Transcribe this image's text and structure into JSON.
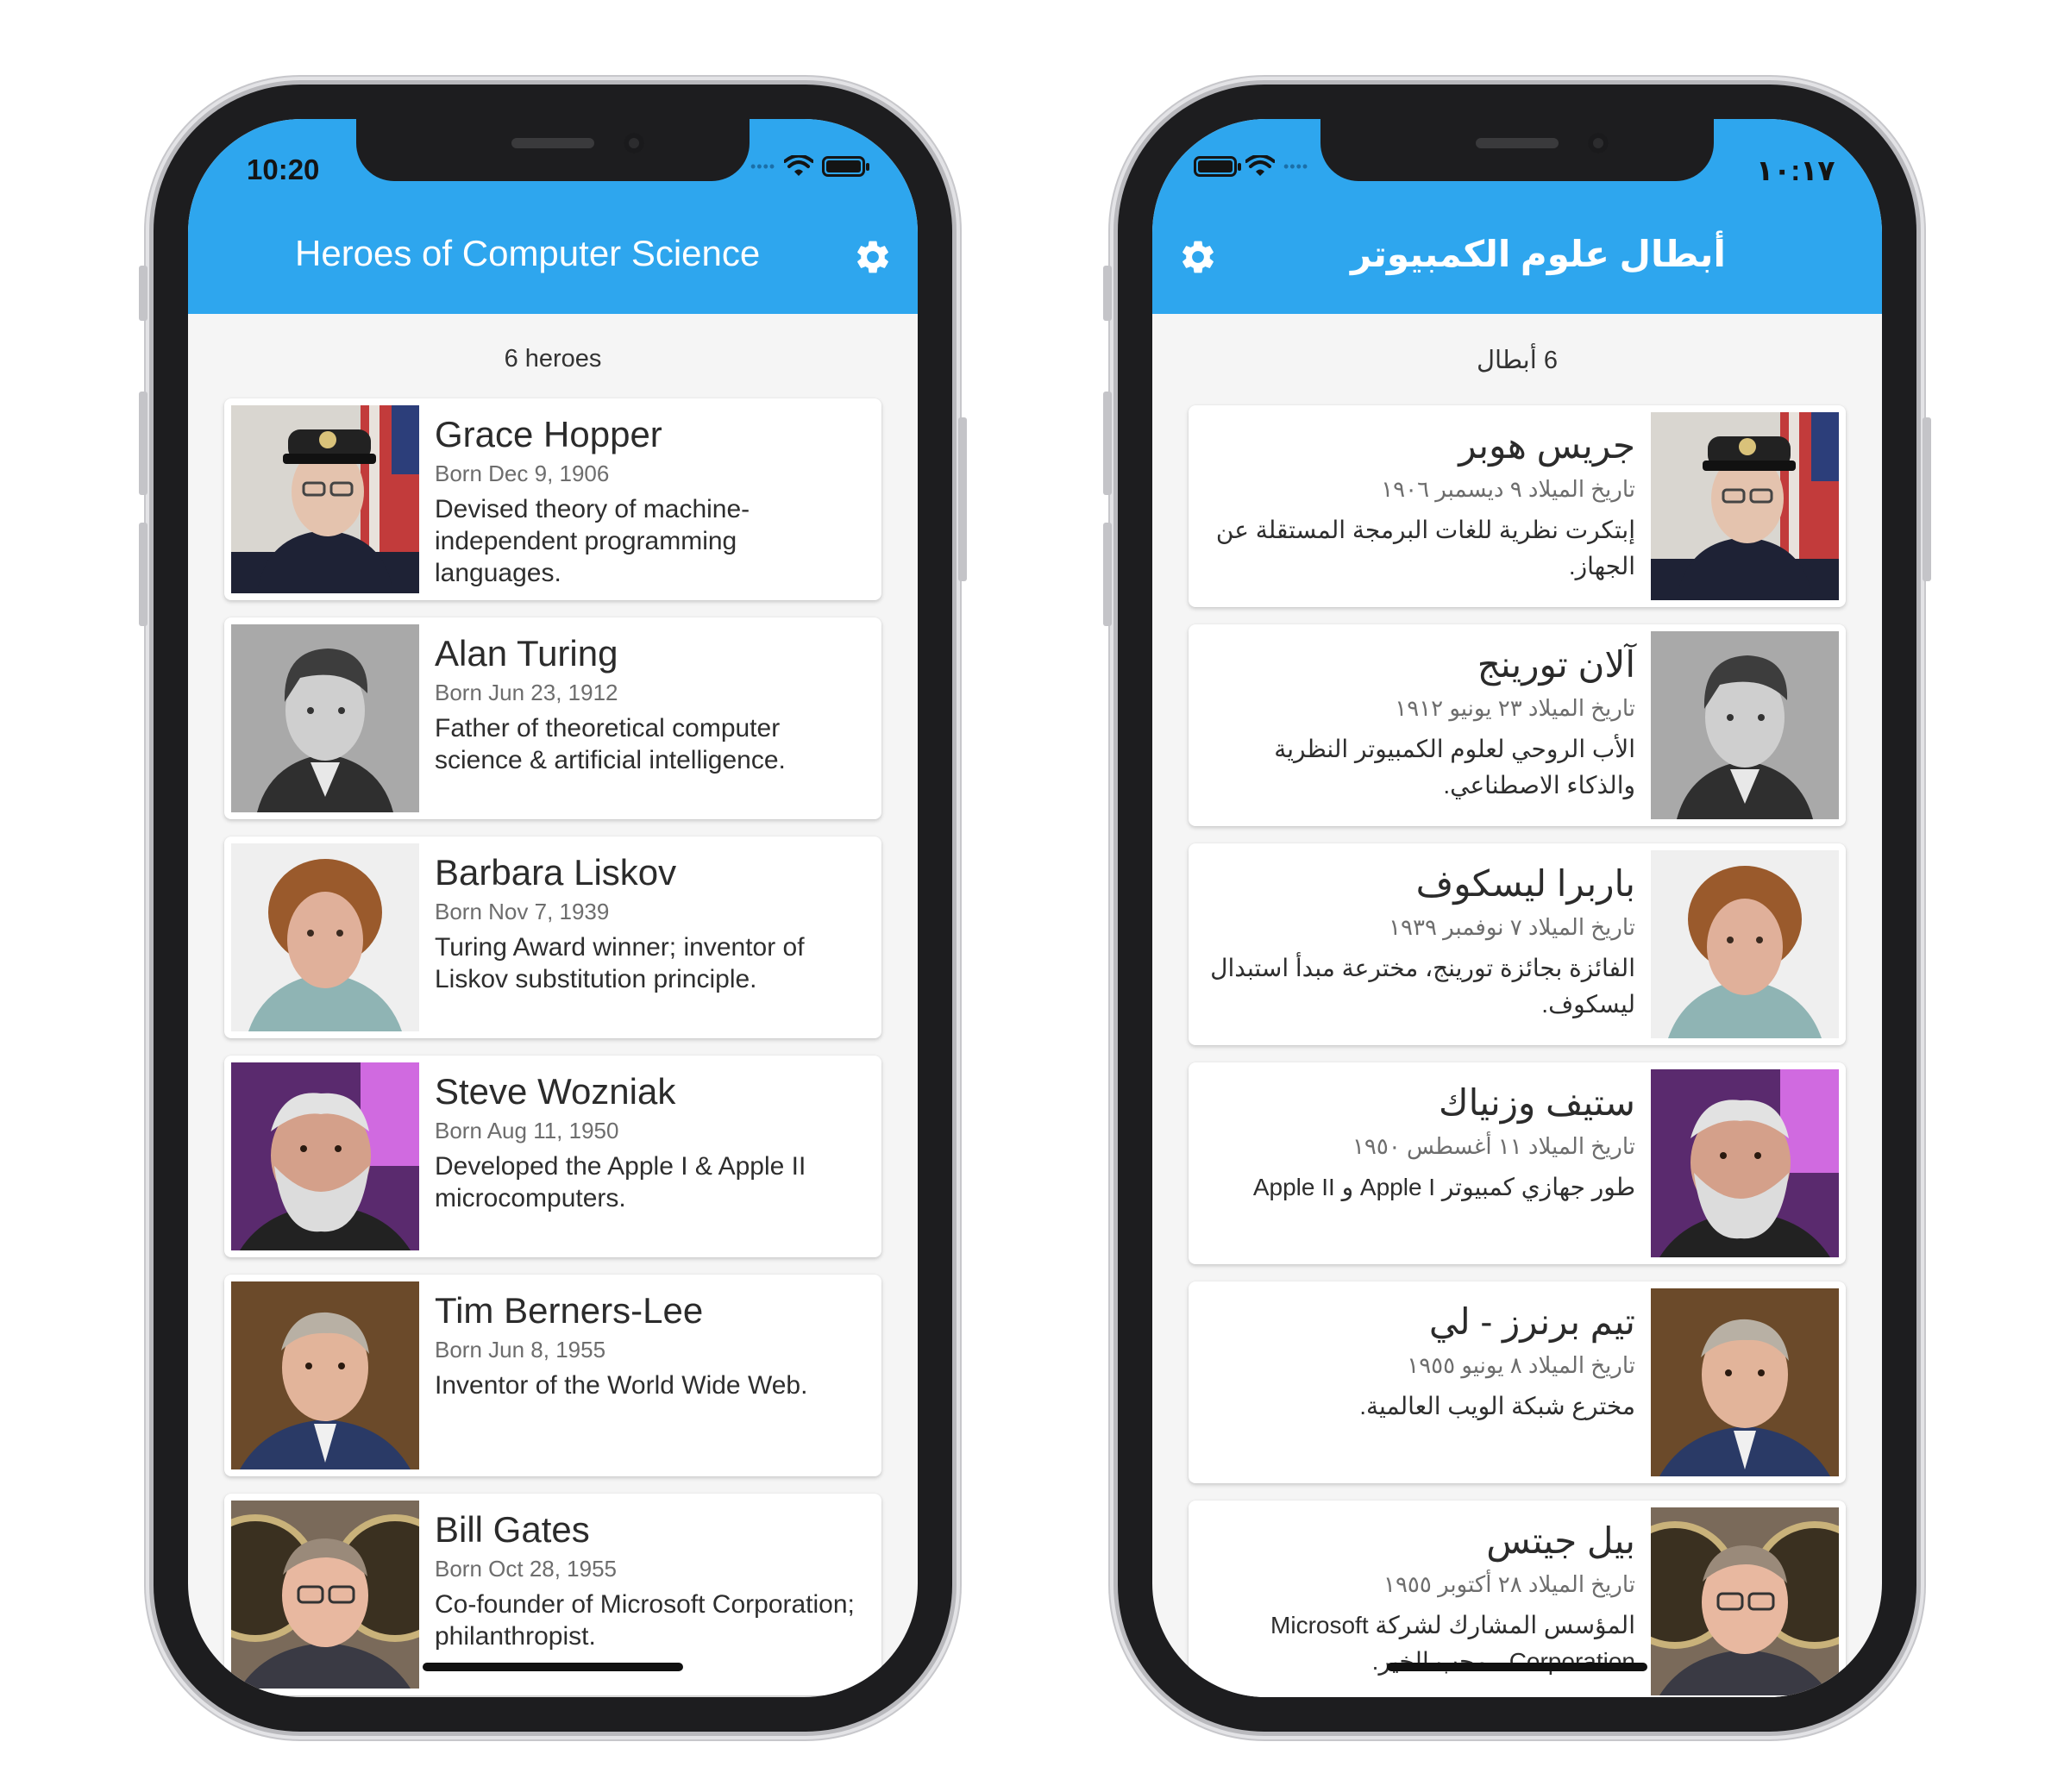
{
  "left": {
    "status": {
      "time": "10:20"
    },
    "title": "Heroes of Computer Science",
    "count": "6 heroes",
    "heroes": [
      {
        "name": "Grace Hopper",
        "born": "Born Dec 9, 1906",
        "desc": "Devised theory of machine-independent programming languages."
      },
      {
        "name": "Alan Turing",
        "born": "Born Jun 23, 1912",
        "desc": "Father of theoretical computer science & artificial intelligence."
      },
      {
        "name": "Barbara Liskov",
        "born": "Born Nov 7, 1939",
        "desc": "Turing Award winner; inventor of Liskov substitution principle."
      },
      {
        "name": "Steve Wozniak",
        "born": "Born Aug 11, 1950",
        "desc": "Developed the Apple I & Apple II microcomputers."
      },
      {
        "name": "Tim Berners-Lee",
        "born": "Born Jun 8, 1955",
        "desc": "Inventor of the World Wide Web."
      },
      {
        "name": "Bill Gates",
        "born": "Born Oct 28, 1955",
        "desc": "Co-founder of Microsoft Corporation; philanthropist."
      }
    ]
  },
  "right": {
    "status": {
      "time": "١٠:١٧"
    },
    "title": "أبطال علوم الكمبيوتر",
    "count": "6 أبطال",
    "heroes": [
      {
        "name": "جريس هوبر",
        "born": "تاريخ الميلاد ٩ ديسمبر ١٩٠٦",
        "desc": "إبتكرت نظرية للغات البرمجة المستقلة عن الجهاز."
      },
      {
        "name": "آلان تورينج",
        "born": "تاريخ الميلاد ٢٣ يونيو ١٩١٢",
        "desc": "الأب الروحي لعلوم الكمبيوتر النظرية والذكاء الاصطناعي."
      },
      {
        "name": "باربرا ليسكوف",
        "born": "تاريخ الميلاد ٧ نوفمبر ١٩٣٩",
        "desc": "الفائزة بجائزة تورينج، مخترعة مبدأ استبدال ليسكوف."
      },
      {
        "name": "ستيف وزنياك",
        "born": "تاريخ الميلاد ١١ أغسطس ١٩٥٠",
        "desc": "طور جهازي كمبيوتر Apple I و Apple II"
      },
      {
        "name": "تيم برنرز - لي",
        "born": "تاريخ الميلاد ٨ يونيو ١٩٥٥",
        "desc": "مخترع شبكة الويب العالمية."
      },
      {
        "name": "بيل جيتس",
        "born": "تاريخ الميلاد ٢٨ أكتوبر ١٩٥٥",
        "desc": "المؤسس المشارك لشركة Microsoft Corporation ، محب الخير."
      }
    ]
  },
  "colors": {
    "appbar": "#2ea6ee",
    "background": "#f5f5f5"
  },
  "icons": {
    "settings": "gear-icon",
    "wifi": "wifi-icon",
    "battery": "battery-icon"
  }
}
